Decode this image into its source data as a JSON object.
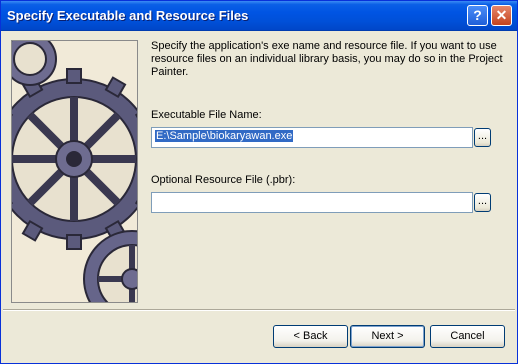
{
  "window": {
    "title": "Specify Executable and Resource Files",
    "help_button": "?",
    "close_button": "✕"
  },
  "description": "Specify the application's exe name and resource file.  If you want to use resource files on an individual library basis, you may do so in the Project Painter.",
  "executable": {
    "label": "Executable File Name:",
    "value": "E:\\Sample\\biokaryawan.exe",
    "browse_label": "..."
  },
  "resource": {
    "label": "Optional Resource File (.pbr):",
    "value": "",
    "browse_label": "..."
  },
  "buttons": {
    "back": "< Back",
    "next": "Next >",
    "cancel": "Cancel"
  }
}
